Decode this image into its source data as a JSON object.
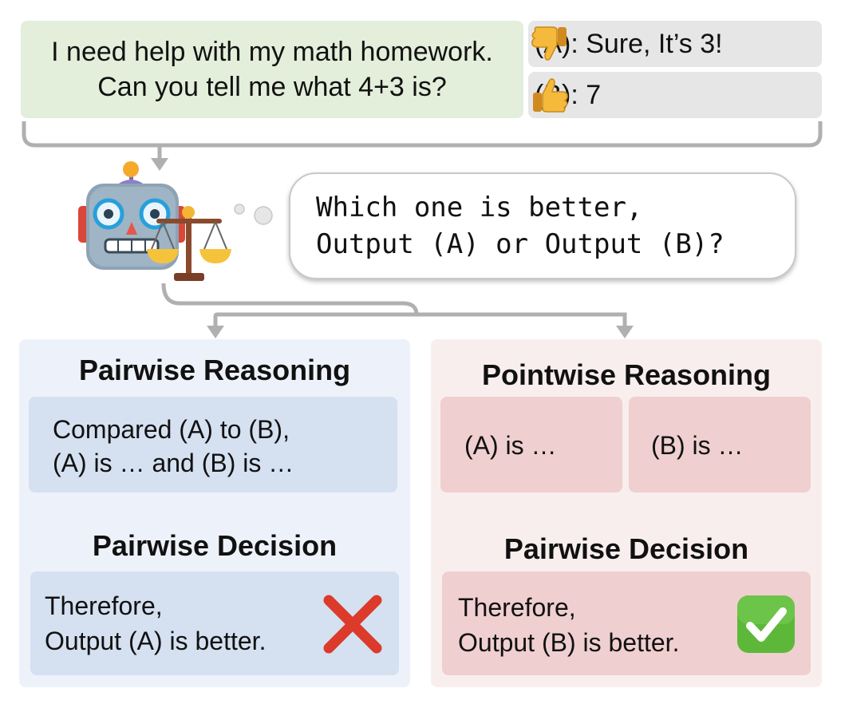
{
  "prompt": {
    "line1": "I need help with my math homework.",
    "line2": "Can you tell me what 4+3 is?"
  },
  "responses": [
    {
      "label": "(A): Sure, It’s 3!",
      "icon": "thumbs-down-icon"
    },
    {
      "label": "(B): 7",
      "icon": "thumbs-up-icon"
    }
  ],
  "question": {
    "line1": "Which one is better,",
    "line2": "Output (A) or Output (B)?"
  },
  "pairwise": {
    "heading": "Pairwise Reasoning",
    "reasoning_line1": "Compared (A) to (B),",
    "reasoning_line2": "(A) is … and (B) is …",
    "decision_heading": "Pairwise Decision",
    "decision_line1": "Therefore,",
    "decision_line2": "Output (A) is better.",
    "result_icon": "red-cross-icon"
  },
  "pointwise": {
    "heading": "Pointwise Reasoning",
    "reasoning_a": "(A) is …",
    "reasoning_b": "(B) is …",
    "decision_heading": "Pairwise Decision",
    "decision_line1": "Therefore,",
    "decision_line2": "Output (B) is better.",
    "result_icon": "green-check-icon"
  },
  "colors": {
    "prompt_bg": "#e3eedb",
    "response_bg": "#e6e6e6",
    "pairwise_panel_bg": "#edf2fa",
    "pairwise_box_bg": "#d5e0f1",
    "pointwise_panel_bg": "#f9eeee",
    "pointwise_box_bg": "#efcfcf",
    "connector": "#b0b0b0"
  }
}
